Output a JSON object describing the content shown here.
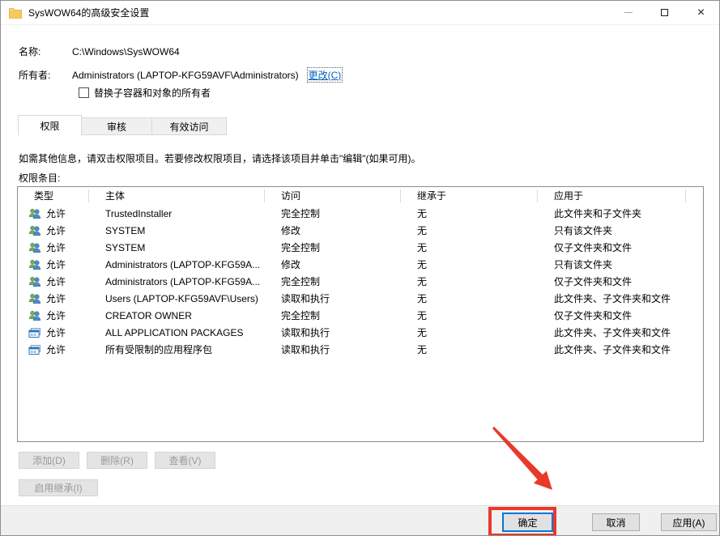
{
  "window": {
    "title": "SysWOW64的高级安全设置"
  },
  "properties": {
    "name_label": "名称:",
    "name_value": "C:\\Windows\\SysWOW64",
    "owner_label": "所有者:",
    "owner_value": "Administrators (LAPTOP-KFG59AVF\\Administrators)",
    "change_link": "更改(C)",
    "replace_owner_checkbox_label": "替换子容器和对象的所有者",
    "replace_owner_checked": false
  },
  "tabs": [
    {
      "label": "权限",
      "active": true
    },
    {
      "label": "审核",
      "active": false
    },
    {
      "label": "有效访问",
      "active": false
    }
  ],
  "permissions": {
    "instruction": "如需其他信息，请双击权限项目。若要修改权限项目，请选择该项目并单击\"编辑\"(如果可用)。",
    "entries_label": "权限条目:",
    "table": {
      "columns": [
        "类型",
        "主体",
        "访问",
        "继承于",
        "应用于"
      ],
      "rows": [
        {
          "icon": "users",
          "type": "允许",
          "principal": "TrustedInstaller",
          "access": "完全控制",
          "inherited_from": "无",
          "applies_to": "此文件夹和子文件夹"
        },
        {
          "icon": "users",
          "type": "允许",
          "principal": "SYSTEM",
          "access": "修改",
          "inherited_from": "无",
          "applies_to": "只有该文件夹"
        },
        {
          "icon": "users",
          "type": "允许",
          "principal": "SYSTEM",
          "access": "完全控制",
          "inherited_from": "无",
          "applies_to": "仅子文件夹和文件"
        },
        {
          "icon": "users",
          "type": "允许",
          "principal": "Administrators (LAPTOP-KFG59A...",
          "access": "修改",
          "inherited_from": "无",
          "applies_to": "只有该文件夹"
        },
        {
          "icon": "users",
          "type": "允许",
          "principal": "Administrators (LAPTOP-KFG59A...",
          "access": "完全控制",
          "inherited_from": "无",
          "applies_to": "仅子文件夹和文件"
        },
        {
          "icon": "users",
          "type": "允许",
          "principal": "Users (LAPTOP-KFG59AVF\\Users)",
          "access": "读取和执行",
          "inherited_from": "无",
          "applies_to": "此文件夹、子文件夹和文件"
        },
        {
          "icon": "users",
          "type": "允许",
          "principal": "CREATOR OWNER",
          "access": "完全控制",
          "inherited_from": "无",
          "applies_to": "仅子文件夹和文件"
        },
        {
          "icon": "package",
          "type": "允许",
          "principal": "ALL APPLICATION PACKAGES",
          "access": "读取和执行",
          "inherited_from": "无",
          "applies_to": "此文件夹、子文件夹和文件"
        },
        {
          "icon": "package",
          "type": "允许",
          "principal": "所有受限制的应用程序包",
          "access": "读取和执行",
          "inherited_from": "无",
          "applies_to": "此文件夹、子文件夹和文件"
        }
      ]
    },
    "buttons": {
      "add": "添加(D)",
      "remove": "删除(R)",
      "view": "查看(V)",
      "enable_inheritance": "启用继承(I)"
    }
  },
  "footer": {
    "ok": "确定",
    "cancel": "取消",
    "apply": "应用(A)"
  },
  "annotation": {
    "color": "#e8392b"
  }
}
